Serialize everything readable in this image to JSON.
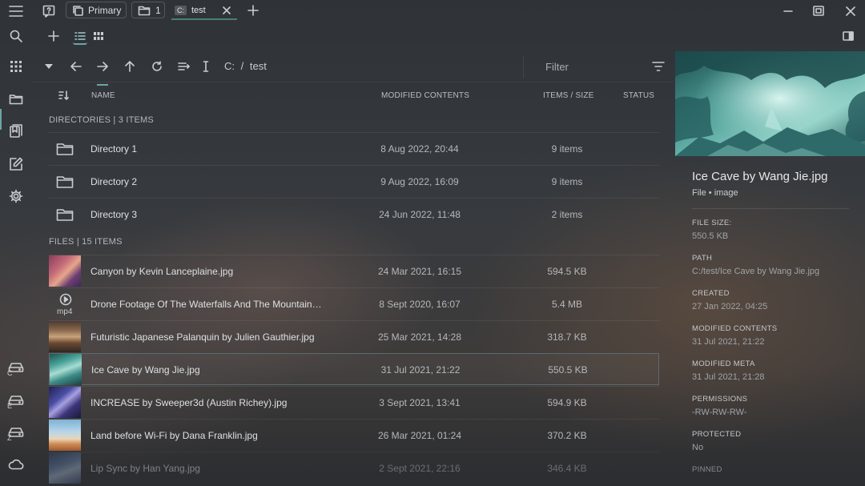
{
  "titlebar": {
    "pane_label": "Primary",
    "tab_count": "1",
    "tab_drive": "C:",
    "tab_label": "test"
  },
  "toolbar": {
    "list_view_active": true
  },
  "nav": {
    "path_drive": "C:",
    "path_sep": "/",
    "path_folder": "test",
    "filter_placeholder": "Filter"
  },
  "columns": {
    "name": "NAME",
    "modified": "MODIFIED CONTENTS",
    "items_size": "ITEMS / SIZE",
    "status": "STATUS"
  },
  "directories_header": "DIRECTORIES | 3 ITEMS",
  "directories": [
    {
      "name": "Directory 1",
      "modified": "8 Aug 2022, 20:44",
      "items": "9 items"
    },
    {
      "name": "Directory 2",
      "modified": "9 Aug 2022, 16:09",
      "items": "9 items"
    },
    {
      "name": "Directory 3",
      "modified": "24 Jun 2022, 11:48",
      "items": "2 items"
    }
  ],
  "files_header": "FILES | 15 ITEMS",
  "files": [
    {
      "name": "Canyon by Kevin Lanceplaine.jpg",
      "modified": "24 Mar 2021, 16:15",
      "size": "594.5 KB",
      "thumb": "canyon"
    },
    {
      "name": "Drone Footage Of The Waterfalls And The Mountain…",
      "modified": "8 Sept 2020, 16:07",
      "size": "5.4 MB",
      "thumb": "video",
      "ext": "mp4"
    },
    {
      "name": "Futuristic Japanese Palanquin by Julien Gauthier.jpg",
      "modified": "25 Mar 2021, 14:28",
      "size": "318.7 KB",
      "thumb": "palanquin"
    },
    {
      "name": "Ice Cave by Wang Jie.jpg",
      "modified": "31 Jul 2021, 21:22",
      "size": "550.5 KB",
      "thumb": "icecave",
      "selected": true
    },
    {
      "name": "INCREASE by Sweeper3d (Austin Richey).jpg",
      "modified": "3 Sept 2021, 13:41",
      "size": "594.9 KB",
      "thumb": "increase"
    },
    {
      "name": "Land before Wi-Fi by Dana Franklin.jpg",
      "modified": "26 Mar 2021, 01:24",
      "size": "370.2 KB",
      "thumb": "land"
    },
    {
      "name": "Lip Sync by Han Yang.jpg",
      "modified": "2 Sept 2021, 22:16",
      "size": "346.4 KB",
      "thumb": "lipsync"
    }
  ],
  "sidebar": {
    "drives": [
      "C",
      "E",
      "Z"
    ]
  },
  "preview": {
    "title": "Ice Cave by Wang Jie.jpg",
    "subtitle": "File • image",
    "meta": [
      {
        "label": "FILE SIZE:",
        "value": "550.5 KB"
      },
      {
        "label": "PATH",
        "value": "C:/test/Ice Cave by Wang Jie.jpg"
      },
      {
        "label": "CREATED",
        "value": "27 Jan 2022, 04:25"
      },
      {
        "label": "MODIFIED CONTENTS",
        "value": "31 Jul 2021, 21:22"
      },
      {
        "label": "MODIFIED META",
        "value": "31 Jul 2021, 21:28"
      },
      {
        "label": "PERMISSIONS",
        "value": "-RW-RW-RW-"
      },
      {
        "label": "PROTECTED",
        "value": "No"
      },
      {
        "label": "PINNED",
        "value": ""
      }
    ]
  },
  "colors": {
    "accent": "#6aa6a3",
    "selected_border": "#5d6a70"
  }
}
